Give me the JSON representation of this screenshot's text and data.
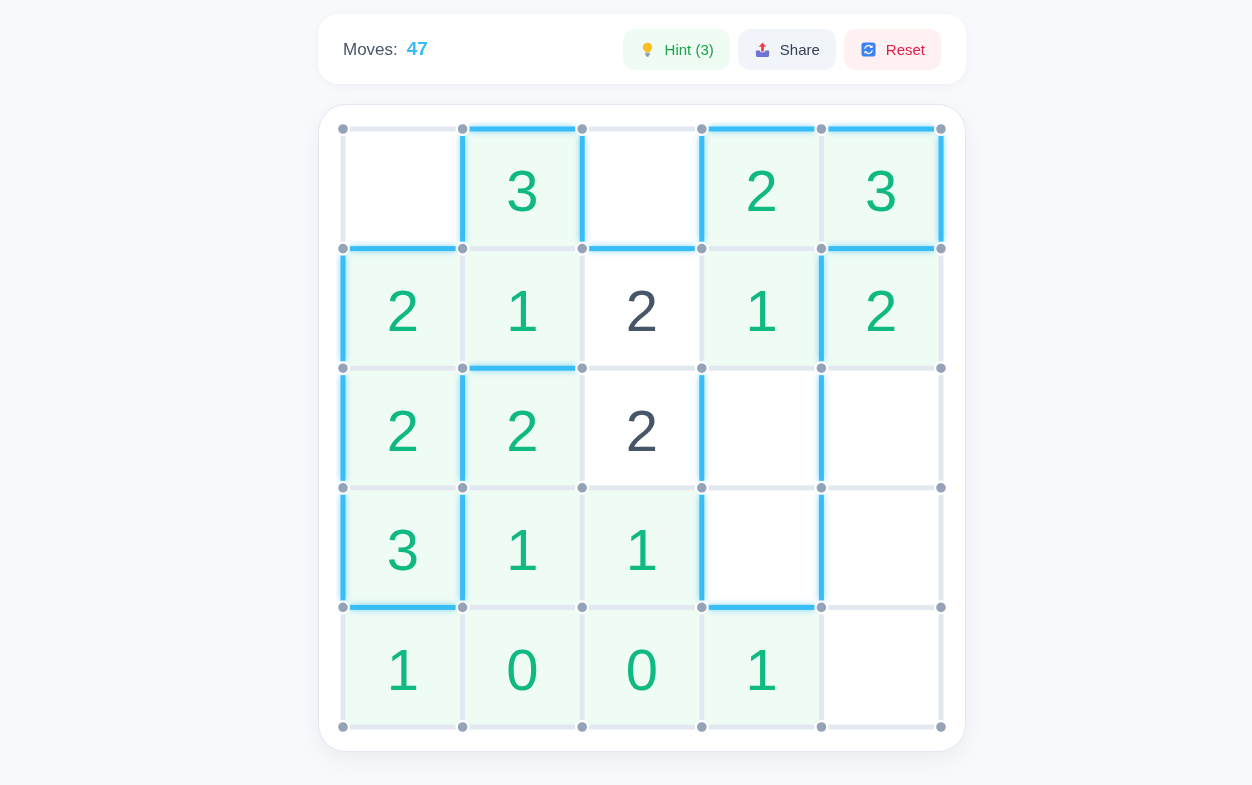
{
  "header": {
    "moves_label": "Moves:",
    "moves_value": "47",
    "buttons": [
      {
        "kind": "hint",
        "label": "Hint (3)"
      },
      {
        "kind": "share",
        "label": "Share"
      },
      {
        "kind": "reset",
        "label": "Reset"
      }
    ]
  },
  "board": {
    "cells": [
      [
        {
          "satisfied": false
        },
        {
          "clue": "3",
          "satisfied": true
        },
        {
          "satisfied": false
        },
        {
          "clue": "2",
          "satisfied": true
        },
        {
          "clue": "3",
          "satisfied": true
        }
      ],
      [
        {
          "clue": "2",
          "satisfied": true
        },
        {
          "clue": "1",
          "satisfied": true
        },
        {
          "clue": "2",
          "satisfied": false
        },
        {
          "clue": "1",
          "satisfied": true
        },
        {
          "clue": "2",
          "satisfied": true
        }
      ],
      [
        {
          "clue": "2",
          "satisfied": true
        },
        {
          "clue": "2",
          "satisfied": true
        },
        {
          "clue": "2",
          "satisfied": false
        },
        {
          "satisfied": false
        },
        {
          "satisfied": false
        }
      ],
      [
        {
          "clue": "3",
          "satisfied": true
        },
        {
          "clue": "1",
          "satisfied": true
        },
        {
          "clue": "1",
          "satisfied": true
        },
        {
          "satisfied": false
        },
        {
          "satisfied": false
        }
      ],
      [
        {
          "clue": "1",
          "satisfied": true
        },
        {
          "clue": "0",
          "satisfied": true
        },
        {
          "clue": "0",
          "satisfied": true
        },
        {
          "clue": "1",
          "satisfied": true
        },
        {
          "satisfied": false
        }
      ]
    ],
    "horizontal_edges": [
      [
        {
          "on": false
        },
        {
          "on": true
        },
        {
          "on": false
        },
        {
          "on": true
        },
        {
          "on": true
        }
      ],
      [
        {
          "on": true
        },
        {
          "on": false
        },
        {
          "on": true
        },
        {
          "on": false
        },
        {
          "on": true
        }
      ],
      [
        {
          "on": false
        },
        {
          "on": true
        },
        {
          "on": false
        },
        {
          "on": false
        },
        {
          "on": false
        }
      ],
      [
        {
          "on": false
        },
        {
          "on": false
        },
        {
          "on": false
        },
        {
          "on": false
        },
        {
          "on": false
        }
      ],
      [
        {
          "on": true
        },
        {
          "on": false
        },
        {
          "on": false
        },
        {
          "on": true
        },
        {
          "on": false
        }
      ],
      [
        {
          "on": false
        },
        {
          "on": false
        },
        {
          "on": false
        },
        {
          "on": false
        },
        {
          "on": false
        }
      ]
    ],
    "vertical_edges": [
      [
        {
          "on": false
        },
        {
          "on": true
        },
        {
          "on": true
        },
        {
          "on": true
        },
        {
          "on": false
        },
        {
          "on": true
        }
      ],
      [
        {
          "on": true
        },
        {
          "on": false
        },
        {
          "on": false
        },
        {
          "on": false
        },
        {
          "on": true
        },
        {
          "on": false
        }
      ],
      [
        {
          "on": true
        },
        {
          "on": true
        },
        {
          "on": false
        },
        {
          "on": true
        },
        {
          "on": true
        },
        {
          "on": false
        }
      ],
      [
        {
          "on": true
        },
        {
          "on": true
        },
        {
          "on": false
        },
        {
          "on": true
        },
        {
          "on": true
        },
        {
          "on": false
        }
      ],
      [
        {
          "on": false
        },
        {
          "on": false
        },
        {
          "on": false
        },
        {
          "on": false
        },
        {
          "on": false
        },
        {
          "on": false
        }
      ]
    ]
  }
}
